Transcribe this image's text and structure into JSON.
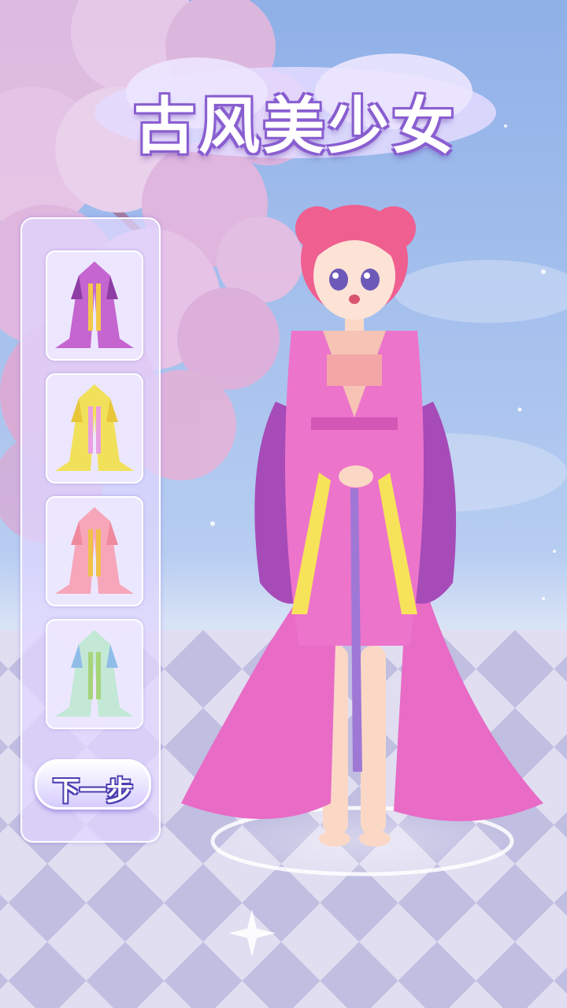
{
  "game": {
    "title": "古风美少女",
    "next_button_label": "下一步"
  },
  "wardrobe": {
    "items": [
      {
        "name": "purple-hanfu-outfit",
        "color": "#b54bc3",
        "accent": "#f6c94b"
      },
      {
        "name": "yellow-hanfu-outfit",
        "color": "#f2e25a",
        "accent": "#e9a0e0"
      },
      {
        "name": "pink-hanfu-outfit",
        "color": "#f6a3b8",
        "accent": "#f0c04a"
      },
      {
        "name": "mint-hanfu-outfit",
        "color": "#bfe6d4",
        "accent": "#8fb8e8"
      }
    ]
  },
  "colors": {
    "sky_top": "#8fb0e8",
    "sky_bottom": "#c7d8f3",
    "floor_light": "#dcd8ef",
    "floor_dark": "#b7b4dc",
    "blossom": "#e9b7dc",
    "dress": "#e86bc6",
    "hair": "#ef5f90"
  }
}
